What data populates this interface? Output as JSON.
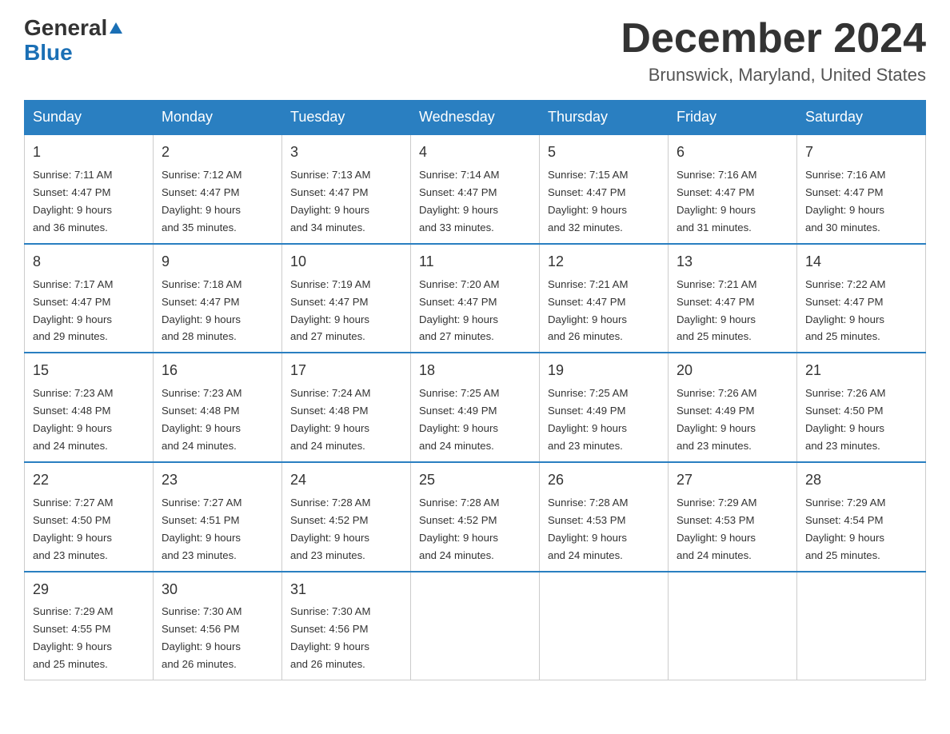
{
  "logo": {
    "general": "General",
    "blue": "Blue"
  },
  "title": "December 2024",
  "subtitle": "Brunswick, Maryland, United States",
  "days_of_week": [
    "Sunday",
    "Monday",
    "Tuesday",
    "Wednesday",
    "Thursday",
    "Friday",
    "Saturday"
  ],
  "weeks": [
    [
      {
        "day": "1",
        "sunrise": "7:11 AM",
        "sunset": "4:47 PM",
        "daylight": "9 hours and 36 minutes."
      },
      {
        "day": "2",
        "sunrise": "7:12 AM",
        "sunset": "4:47 PM",
        "daylight": "9 hours and 35 minutes."
      },
      {
        "day": "3",
        "sunrise": "7:13 AM",
        "sunset": "4:47 PM",
        "daylight": "9 hours and 34 minutes."
      },
      {
        "day": "4",
        "sunrise": "7:14 AM",
        "sunset": "4:47 PM",
        "daylight": "9 hours and 33 minutes."
      },
      {
        "day": "5",
        "sunrise": "7:15 AM",
        "sunset": "4:47 PM",
        "daylight": "9 hours and 32 minutes."
      },
      {
        "day": "6",
        "sunrise": "7:16 AM",
        "sunset": "4:47 PM",
        "daylight": "9 hours and 31 minutes."
      },
      {
        "day": "7",
        "sunrise": "7:16 AM",
        "sunset": "4:47 PM",
        "daylight": "9 hours and 30 minutes."
      }
    ],
    [
      {
        "day": "8",
        "sunrise": "7:17 AM",
        "sunset": "4:47 PM",
        "daylight": "9 hours and 29 minutes."
      },
      {
        "day": "9",
        "sunrise": "7:18 AM",
        "sunset": "4:47 PM",
        "daylight": "9 hours and 28 minutes."
      },
      {
        "day": "10",
        "sunrise": "7:19 AM",
        "sunset": "4:47 PM",
        "daylight": "9 hours and 27 minutes."
      },
      {
        "day": "11",
        "sunrise": "7:20 AM",
        "sunset": "4:47 PM",
        "daylight": "9 hours and 27 minutes."
      },
      {
        "day": "12",
        "sunrise": "7:21 AM",
        "sunset": "4:47 PM",
        "daylight": "9 hours and 26 minutes."
      },
      {
        "day": "13",
        "sunrise": "7:21 AM",
        "sunset": "4:47 PM",
        "daylight": "9 hours and 25 minutes."
      },
      {
        "day": "14",
        "sunrise": "7:22 AM",
        "sunset": "4:47 PM",
        "daylight": "9 hours and 25 minutes."
      }
    ],
    [
      {
        "day": "15",
        "sunrise": "7:23 AM",
        "sunset": "4:48 PM",
        "daylight": "9 hours and 24 minutes."
      },
      {
        "day": "16",
        "sunrise": "7:23 AM",
        "sunset": "4:48 PM",
        "daylight": "9 hours and 24 minutes."
      },
      {
        "day": "17",
        "sunrise": "7:24 AM",
        "sunset": "4:48 PM",
        "daylight": "9 hours and 24 minutes."
      },
      {
        "day": "18",
        "sunrise": "7:25 AM",
        "sunset": "4:49 PM",
        "daylight": "9 hours and 24 minutes."
      },
      {
        "day": "19",
        "sunrise": "7:25 AM",
        "sunset": "4:49 PM",
        "daylight": "9 hours and 23 minutes."
      },
      {
        "day": "20",
        "sunrise": "7:26 AM",
        "sunset": "4:49 PM",
        "daylight": "9 hours and 23 minutes."
      },
      {
        "day": "21",
        "sunrise": "7:26 AM",
        "sunset": "4:50 PM",
        "daylight": "9 hours and 23 minutes."
      }
    ],
    [
      {
        "day": "22",
        "sunrise": "7:27 AM",
        "sunset": "4:50 PM",
        "daylight": "9 hours and 23 minutes."
      },
      {
        "day": "23",
        "sunrise": "7:27 AM",
        "sunset": "4:51 PM",
        "daylight": "9 hours and 23 minutes."
      },
      {
        "day": "24",
        "sunrise": "7:28 AM",
        "sunset": "4:52 PM",
        "daylight": "9 hours and 23 minutes."
      },
      {
        "day": "25",
        "sunrise": "7:28 AM",
        "sunset": "4:52 PM",
        "daylight": "9 hours and 24 minutes."
      },
      {
        "day": "26",
        "sunrise": "7:28 AM",
        "sunset": "4:53 PM",
        "daylight": "9 hours and 24 minutes."
      },
      {
        "day": "27",
        "sunrise": "7:29 AM",
        "sunset": "4:53 PM",
        "daylight": "9 hours and 24 minutes."
      },
      {
        "day": "28",
        "sunrise": "7:29 AM",
        "sunset": "4:54 PM",
        "daylight": "9 hours and 25 minutes."
      }
    ],
    [
      {
        "day": "29",
        "sunrise": "7:29 AM",
        "sunset": "4:55 PM",
        "daylight": "9 hours and 25 minutes."
      },
      {
        "day": "30",
        "sunrise": "7:30 AM",
        "sunset": "4:56 PM",
        "daylight": "9 hours and 26 minutes."
      },
      {
        "day": "31",
        "sunrise": "7:30 AM",
        "sunset": "4:56 PM",
        "daylight": "9 hours and 26 minutes."
      },
      null,
      null,
      null,
      null
    ]
  ],
  "labels": {
    "sunrise": "Sunrise:",
    "sunset": "Sunset:",
    "daylight": "Daylight:"
  }
}
